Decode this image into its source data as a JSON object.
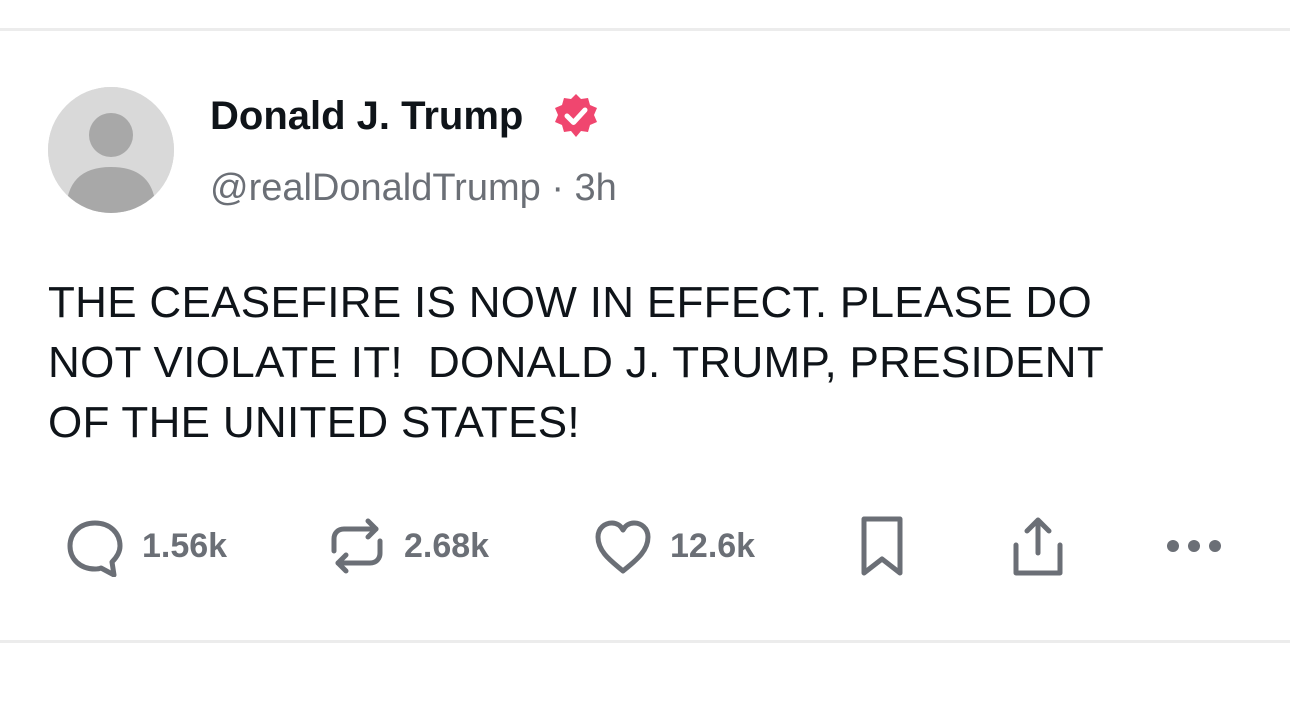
{
  "post": {
    "author_name": "Donald J. Trump",
    "verified": true,
    "handle": "@realDonaldTrump",
    "separator": "·",
    "timestamp": "3h",
    "text": "THE CEASEFIRE IS NOW IN EFFECT. PLEASE DO\nNOT VIOLATE IT!  DONALD J. TRUMP, PRESIDENT\nOF THE UNITED STATES!",
    "avatar_icon": "avatar-placeholder"
  },
  "actions": {
    "reply_count": "1.56k",
    "repost_count": "2.68k",
    "like_count": "12.6k",
    "icons": [
      "reply-icon",
      "repost-icon",
      "like-icon",
      "bookmark-icon",
      "share-icon",
      "more-icon"
    ]
  },
  "colors": {
    "background": "#ffffff",
    "text_primary": "#0f1419",
    "text_secondary": "#6b6f76",
    "verified_badge": "#f0466f",
    "divider": "#ececec"
  }
}
